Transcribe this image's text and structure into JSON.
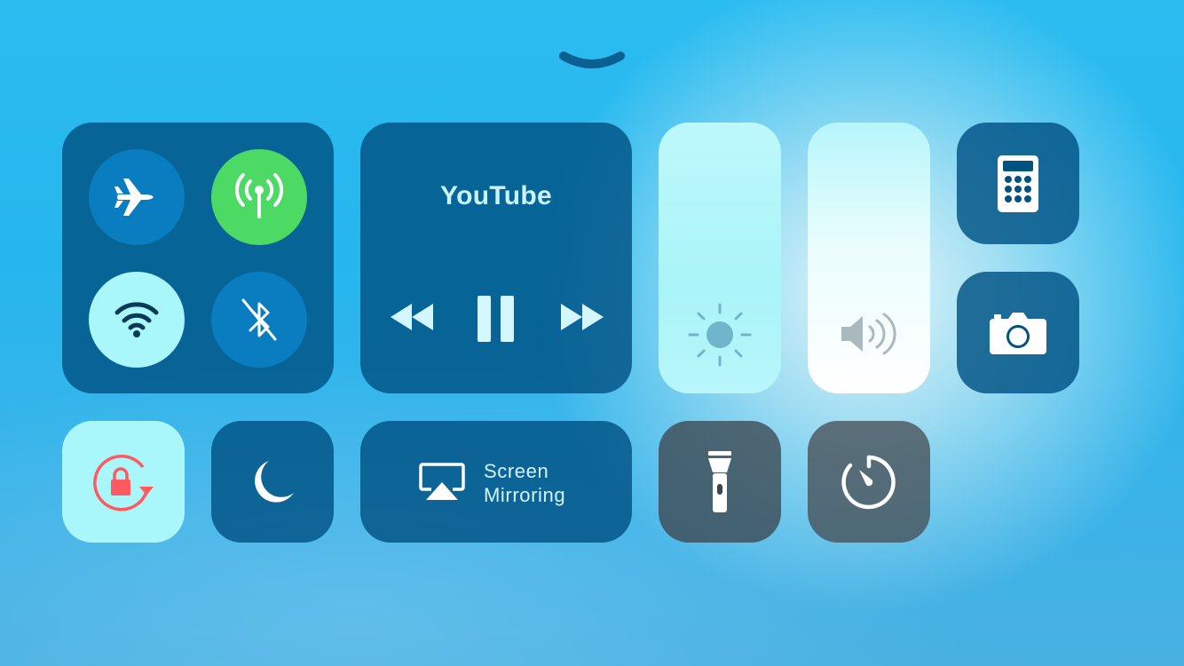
{
  "control_center": {
    "dismiss_icon": "chevron-down-icon",
    "connectivity": {
      "airplane": {
        "icon": "airplane-icon",
        "state": "off"
      },
      "cellular": {
        "icon": "cellular-antenna-icon",
        "state": "on",
        "color": "#4cd964"
      },
      "wifi": {
        "icon": "wifi-icon",
        "state": "on"
      },
      "bluetooth": {
        "icon": "bluetooth-off-icon",
        "state": "off"
      }
    },
    "media": {
      "title": "YouTube",
      "controls": [
        "rewind-icon",
        "pause-icon",
        "fast-forward-icon"
      ]
    },
    "brightness": {
      "icon": "sun-icon",
      "level_fraction": 1.0
    },
    "volume": {
      "icon": "speaker-icon",
      "level_fraction": 1.0
    },
    "shortcuts": {
      "calculator": {
        "icon": "calculator-icon"
      },
      "camera": {
        "icon": "camera-icon"
      },
      "orientation_lock": {
        "icon": "rotation-lock-icon",
        "state": "on",
        "color": "#ff5a5f"
      },
      "do_not_disturb": {
        "icon": "moon-icon",
        "state": "off"
      },
      "screen_mirroring": {
        "icon": "airplay-icon",
        "label_line1": "Screen",
        "label_line2": "Mirroring"
      },
      "flashlight": {
        "icon": "flashlight-icon"
      },
      "timer": {
        "icon": "timer-icon"
      }
    },
    "colors": {
      "tile": "#00527f",
      "active_light": "#a8f6fb",
      "airplane_blue": "#0a7dc0"
    }
  }
}
